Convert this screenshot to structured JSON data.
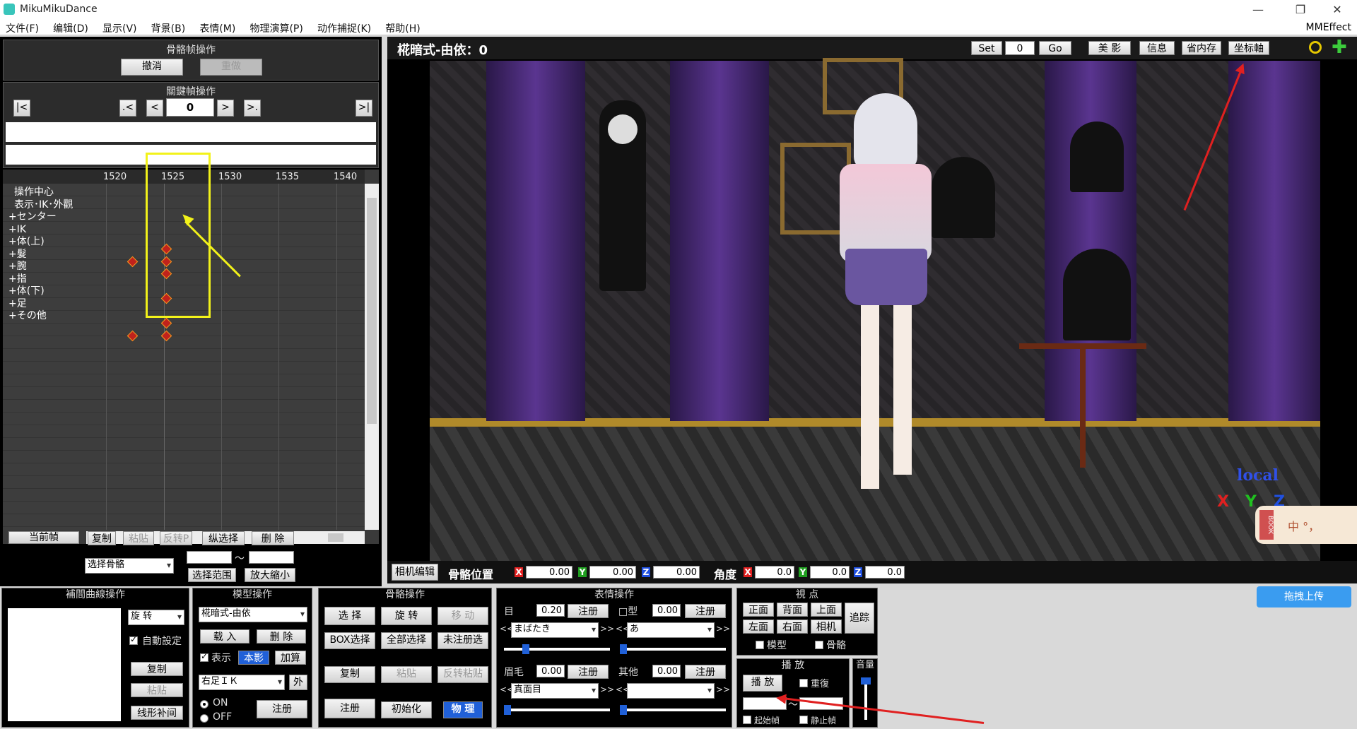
{
  "window": {
    "title": "MikuMikuDance",
    "minimize": "—",
    "restore": "❐",
    "close": "✕"
  },
  "menu": {
    "items": [
      "文件(F)",
      "编辑(D)",
      "显示(V)",
      "背景(B)",
      "表情(M)",
      "物理演算(P)",
      "动作捕捉(K)",
      "帮助(H)"
    ],
    "right": "MMEffect"
  },
  "bone_frame_op": {
    "title": "骨骼帧操作",
    "undo": "撤消",
    "redo": "重做"
  },
  "keyframe_op": {
    "title": "關鍵幀操作",
    "first": "|<",
    "prev_key": ".<",
    "prev": "<",
    "frame": "0",
    "next": ">",
    "next_key": ">.",
    "last": ">|"
  },
  "timeline": {
    "ruler": [
      "1520",
      "1525",
      "1530",
      "1535",
      "1540"
    ],
    "tracks": [
      "操作中心",
      "表示･IK･外觀",
      "+センター",
      "+IK",
      "+体(上)",
      "+髮",
      "+腕",
      "+指",
      "+体(下)",
      "+足",
      "+その他"
    ],
    "current_frame_label": "当前幀"
  },
  "frame_edit": {
    "copy": "复制",
    "paste": "粘贴",
    "reverse_paste": "反转P",
    "vertical_select": "纵选择",
    "delete": "删 除",
    "select_bone": "选择骨骼",
    "range_select": "选择范围",
    "zoom": "放大縮小",
    "tilde": "～"
  },
  "viewport": {
    "model_title": "椛暗式-由依：0",
    "set": "Set",
    "frame_input": "0",
    "go": "Go",
    "beauty": "美 影",
    "info": "信息",
    "save_mem": "省内存",
    "axis": "坐标軸",
    "local": "local",
    "x": "X",
    "y": "Y",
    "z": "Z"
  },
  "bone_pos_bar": {
    "camera_edit": "相机编辑",
    "bone_pos": "骨骼位置",
    "angle": "角度",
    "pos": [
      "0.00",
      "0.00",
      "0.00"
    ],
    "rot": [
      "0.0",
      "0.0",
      "0.0"
    ],
    "x": "X",
    "y": "Y",
    "z": "Z"
  },
  "interp_panel": {
    "title": "補間曲線操作",
    "rotate": "旋 转",
    "auto_set": "自動設定",
    "copy": "复制",
    "paste": "粘贴",
    "linear": "线形补间"
  },
  "model_panel": {
    "title": "模型操作",
    "model": "椛暗式-由依",
    "load": "载 入",
    "delete": "删 除",
    "show": "表示",
    "shadow": "本影",
    "add": "加算",
    "ik": "右足ＩＫ",
    "outside": "外",
    "on": "ON",
    "off": "OFF",
    "register": "注册"
  },
  "bone_panel": {
    "title": "骨骼操作",
    "select": "选 择",
    "rotate": "旋 转",
    "move": "移 动",
    "box_select": "BOX选择",
    "select_all": "全部选择",
    "unregistered": "未注册选",
    "copy": "复制",
    "paste": "粘贴",
    "reverse_paste": "反转粘贴",
    "register": "注册",
    "init": "初始化",
    "physics": "物 理"
  },
  "morph_panel": {
    "title": "表情操作",
    "eye": "目",
    "eye_val": "0.20",
    "eye_morph": "まばたき",
    "mouth": "□型",
    "mouth_val": "0.00",
    "mouth_morph": "あ",
    "brow": "眉毛",
    "brow_val": "0.00",
    "brow_morph": "真面目",
    "other": "其他",
    "other_val": "0.00",
    "other_morph": "",
    "register": "注册",
    "prev": "<<",
    "next": ">>"
  },
  "view_panel": {
    "title": "視 点",
    "front": "正面",
    "back": "背面",
    "top": "上面",
    "left": "左面",
    "right": "右面",
    "camera": "相机",
    "track": "追踪",
    "model": "模型",
    "bone": "骨骼"
  },
  "play_panel": {
    "title": "播 放",
    "play": "播 放",
    "repeat": "重復",
    "start": "起始幀",
    "stop": "静止幀",
    "tilde": "～"
  },
  "volume_panel": {
    "title": "音量"
  },
  "overlay": {
    "upload": "拖拽上传",
    "ime": "中 °，",
    "book": "BOOK"
  },
  "colors": {
    "highlight_box": "#f2f21a",
    "annotation_arrow": "#e02020",
    "key_diamond": "#c0221c"
  }
}
